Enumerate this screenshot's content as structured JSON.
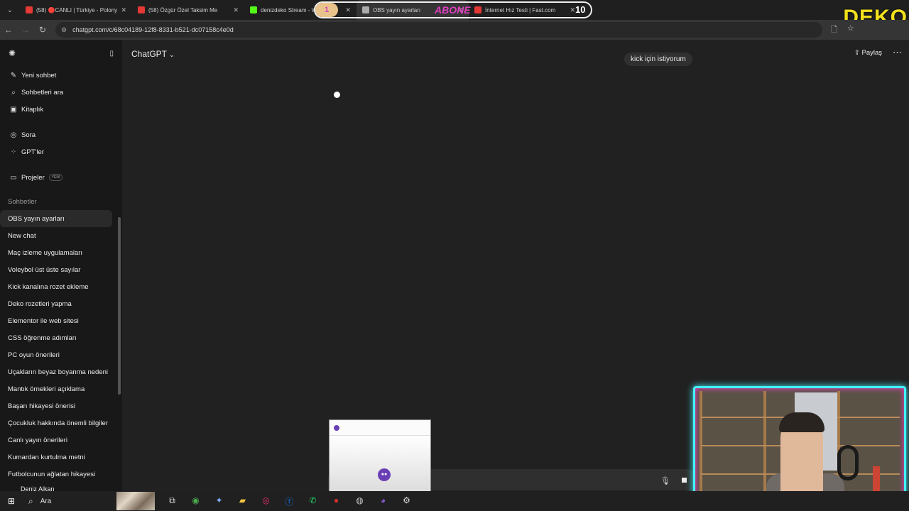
{
  "tabs": [
    {
      "title": "(58) 🔴CANLI | Türkiye - Polony",
      "favicon_color": "#e53935"
    },
    {
      "title": "(58) Özgür Özel Taksim Me",
      "favicon_color": "#e53935"
    },
    {
      "title": "denizdeko Stream - W",
      "favicon_color": "#53fc18"
    },
    {
      "title": "OBS yayın ayarları",
      "favicon_color": "#aaaaaa"
    },
    {
      "title": "İnternet Hız Testi | Fast.com",
      "favicon_color": "#e53935"
    }
  ],
  "overlay": {
    "abone_label": "ABONE",
    "abone_count": "10",
    "abone_progress": "1",
    "brand": "DEKO"
  },
  "browser": {
    "url": "chatgpt.com/c/68c04189-12f8-8331-b521-dc07158c4e0d"
  },
  "sidebar": {
    "top_items": [
      {
        "label": "Yeni sohbet",
        "icon": "edit-icon",
        "glyph": "✎"
      },
      {
        "label": "Sohbetleri ara",
        "icon": "search-icon",
        "glyph": "⌕"
      },
      {
        "label": "Kitaplık",
        "icon": "library-icon",
        "glyph": "▣"
      }
    ],
    "mid_items": [
      {
        "label": "Sora",
        "icon": "sora-icon",
        "glyph": "◎"
      },
      {
        "label": "GPT'ler",
        "icon": "gpts-icon",
        "glyph": "⁘"
      }
    ],
    "projects": {
      "label": "Projeler",
      "badge": "YENİ"
    },
    "section_label": "Sohbetler",
    "chats": [
      "OBS yayın ayarları",
      "New chat",
      "Maç izleme uygulamaları",
      "Voleybol üst üste sayılar",
      "Kick kanalına rozet ekleme",
      "Deko rozetleri yapma",
      "Elementor ile web sitesi",
      "CSS öğrenme adımları",
      "PC oyun önerileri",
      "Uçakların beyaz boyanma nedeni",
      "Mantık örnekleri açıklama",
      "Başarı hikayesi önerisi",
      "Çocukluk hakkında önemli bilgiler",
      "Canlı yayın önerileri",
      "Kumardan kurtulma metni",
      "Futbolcunun ağlatan hikayesi"
    ],
    "user_name": "Deniz Alkan"
  },
  "main": {
    "model_title": "ChatGPT",
    "share_label": "Paylaş",
    "user_message": "kick için istiyorum"
  },
  "taskbar": {
    "search_label": "Ara",
    "icons": [
      {
        "name": "task-view-icon",
        "glyph": "⧉",
        "color": "#dddddd"
      },
      {
        "name": "chrome-icon",
        "glyph": "◉",
        "color": "#4caf50"
      },
      {
        "name": "copilot-icon",
        "glyph": "✦",
        "color": "#7fb3ff"
      },
      {
        "name": "file-explorer-icon",
        "glyph": "▰",
        "color": "#f5c542"
      },
      {
        "name": "instagram-icon",
        "glyph": "◎",
        "color": "#e1306c"
      },
      {
        "name": "facebook-icon",
        "glyph": "ⓕ",
        "color": "#1877f2"
      },
      {
        "name": "whatsapp-icon",
        "glyph": "✆",
        "color": "#25d366"
      },
      {
        "name": "record-app-icon",
        "glyph": "●",
        "color": "#d32f2f"
      },
      {
        "name": "obs-icon",
        "glyph": "◍",
        "color": "#cccccc"
      },
      {
        "name": "chat-app-icon",
        "glyph": "◕",
        "color": "#8a5cd6"
      },
      {
        "name": "settings-icon",
        "glyph": "⚙",
        "color": "#dddddd"
      }
    ]
  }
}
